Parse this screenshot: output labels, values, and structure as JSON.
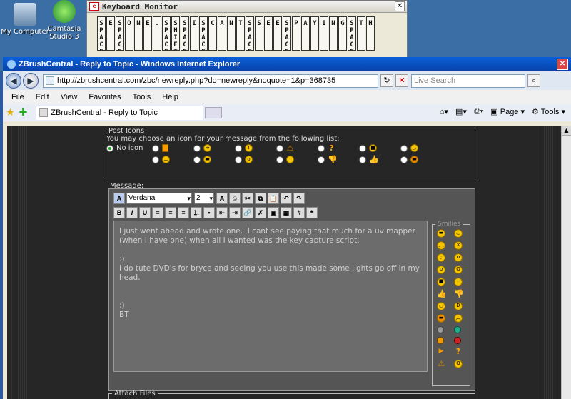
{
  "desktop": {
    "icons": [
      {
        "label": "My Computer"
      },
      {
        "label": "Camtasia Studio 3"
      }
    ]
  },
  "keyboard_monitor": {
    "title": "Keyboard Monitor",
    "close": "✕",
    "keys": [
      "SPACE",
      "E",
      "SPACE",
      "O",
      "N",
      "E",
      ".",
      "SPACE",
      "SHIFT",
      "SPACE",
      "I",
      "SPACE",
      "C",
      "A",
      "N",
      "T",
      "SPACE",
      "S",
      "E",
      "E",
      "SPACE",
      "P",
      "A",
      "Y",
      "I",
      "N",
      "G",
      "SPACE",
      "T",
      "H"
    ]
  },
  "browser": {
    "title": "ZBrushCentral - Reply to Topic - Windows Internet Explorer",
    "url": "http://zbrushcentral.com/zbc/newreply.php?do=newreply&noquote=1&p=368735",
    "search_placeholder": "Live Search",
    "menu": [
      "File",
      "Edit",
      "View",
      "Favorites",
      "Tools",
      "Help"
    ],
    "tab_title": "ZBrushCentral - Reply to Topic",
    "page_btn": "Page",
    "tools_btn": "Tools"
  },
  "post_icons": {
    "legend": "Post Icons",
    "description": "You may choose an icon for your message from the following list:",
    "no_icon_label": "No icon"
  },
  "message": {
    "label": "Message:",
    "font": "Verdana",
    "size": "2",
    "body": "I just went ahead and wrote one.  I cant see paying that much for a uv mapper (when I have one) when all I wanted was the key capture script.\n\n:)\nI do tute DVD's for bryce and seeing you use this made some lights go off in my head.\n\n\n:)\nBT",
    "smilies_legend": "Smilies"
  },
  "attach": {
    "legend": "Attach Files"
  },
  "colors": {
    "page_bg": "#262626",
    "titlebar": "#0a5fd8"
  }
}
